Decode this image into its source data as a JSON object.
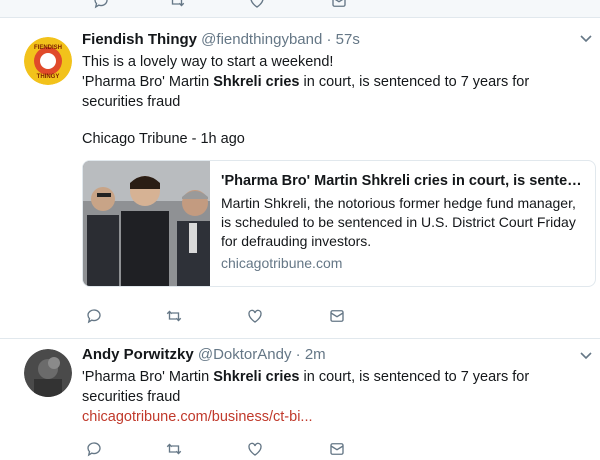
{
  "tweets": [
    {
      "name": "Fiendish Thingy",
      "handle": "@fiendthingyband",
      "time": "57s",
      "intro": "This is a lovely way to start a weekend!",
      "body_pre": "'Pharma Bro' Martin ",
      "body_bold": "Shkreli cries",
      "body_post": " in court, is sentenced to 7 years for securities fraud",
      "source_line": "Chicago Tribune - 1h ago",
      "avatar_text_top": "FIENDISH",
      "avatar_text_bottom": "THINGY",
      "card": {
        "title": "'Pharma Bro' Martin Shkreli cries in court, is senten...",
        "description": "Martin Shkreli, the notorious former hedge fund manager, is scheduled to be sentenced in U.S. District Court Friday for defrauding investors.",
        "domain": "chicagotribune.com"
      }
    },
    {
      "name": "Andy Porwitzky",
      "handle": "@DoktorAndy",
      "time": "2m",
      "body_pre": "'Pharma Bro' Martin ",
      "body_bold": "Shkreli cries",
      "body_post": " in court, is sentenced to 7 years for securities fraud",
      "link": "chicagotribune.com/business/ct-bi..."
    }
  ],
  "icons": [
    "reply-icon",
    "retweet-icon",
    "like-icon",
    "dm-icon",
    "caret-down-icon"
  ],
  "colors": {
    "link": "#c0392b",
    "muted": "#657786",
    "border": "#e1e8ed"
  }
}
